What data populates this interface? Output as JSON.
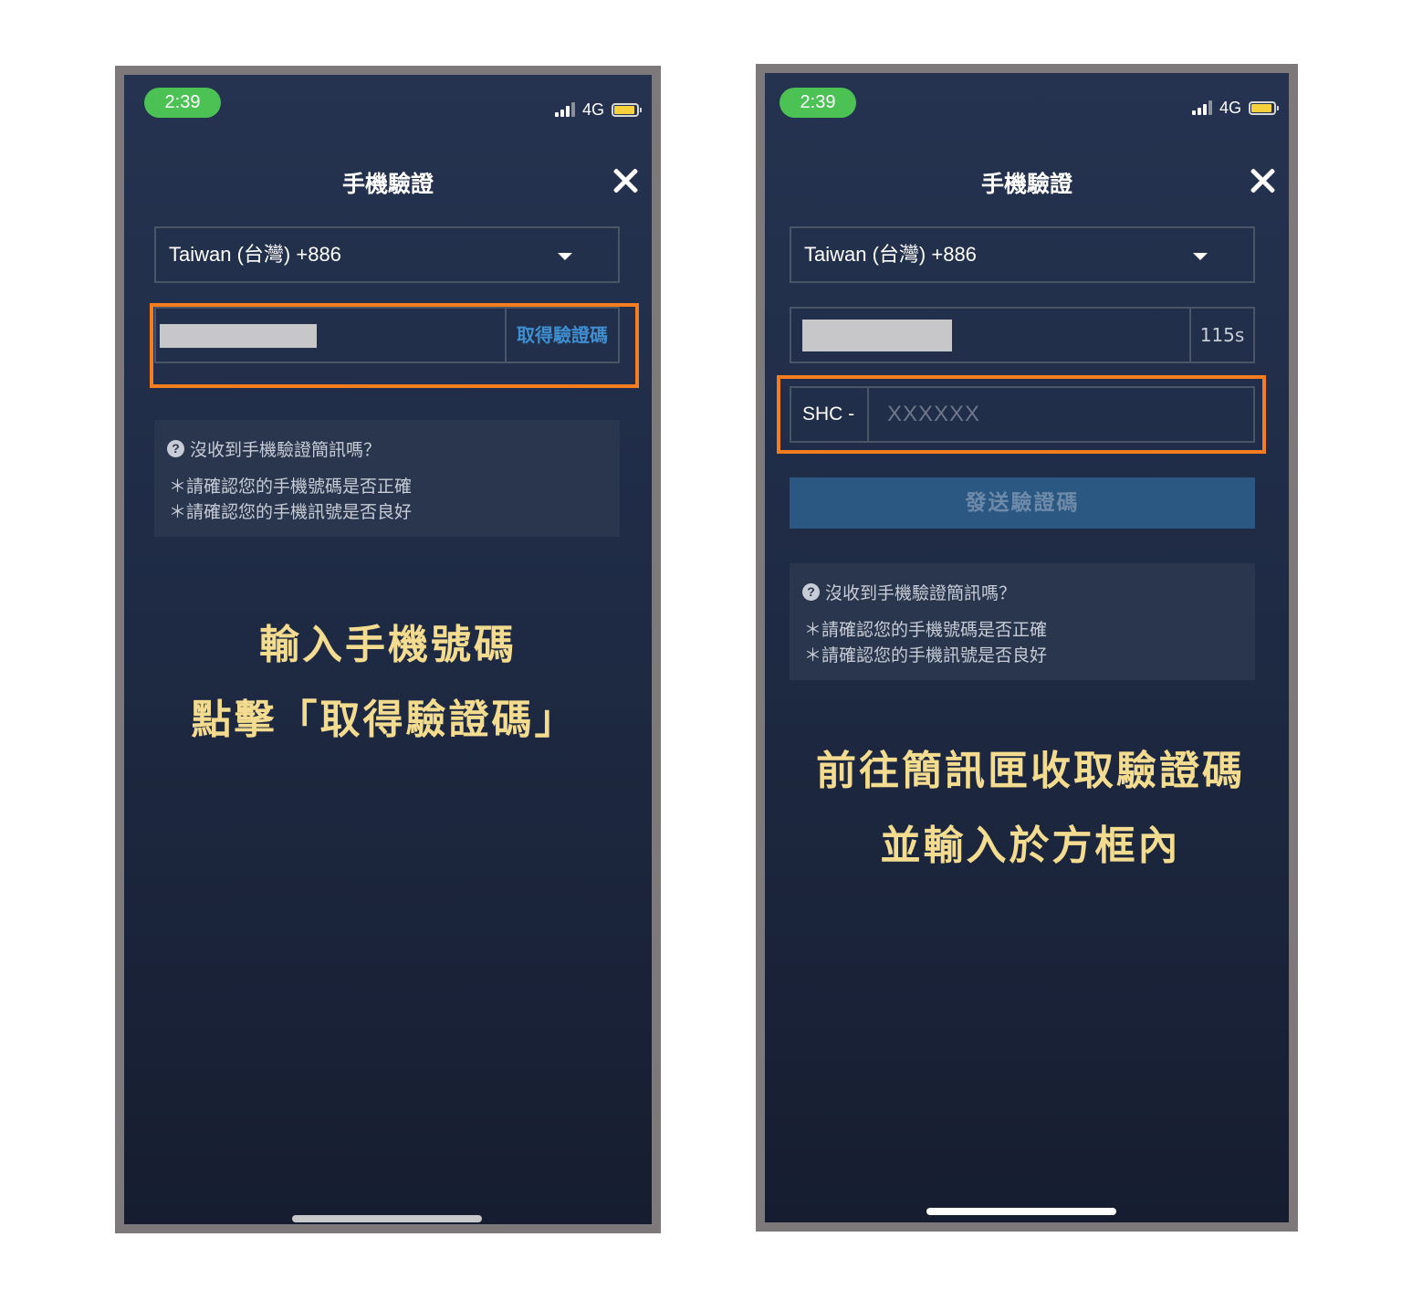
{
  "panels": [
    {
      "status_time": "2:39",
      "network": "4G",
      "title": "手機驗證",
      "country": "Taiwan (台灣) +886",
      "phone_action": "取得驗證碼",
      "help": {
        "heading": "沒收到手機驗證簡訊嗎？",
        "lines": [
          "＊請確認您的手機號碼是否正確",
          "＊請確認您的手機訊號是否良好"
        ]
      },
      "captions": [
        "輸入手機號碼",
        "點擊「取得驗證碼」"
      ]
    },
    {
      "status_time": "2:39",
      "network": "4G",
      "title": "手機驗證",
      "country": "Taiwan (台灣) +886",
      "countdown": "115s",
      "code_prefix": "SHC -",
      "code_placeholder": "XXXXXX",
      "send_label": "發送驗證碼",
      "help": {
        "heading": "沒收到手機驗證簡訊嗎？",
        "lines": [
          "＊請確認您的手機號碼是否正確",
          "＊請確認您的手機訊號是否良好"
        ]
      },
      "captions": [
        "前往簡訊匣收取驗證碼",
        "並輸入於方框內"
      ]
    }
  ],
  "colors": {
    "highlight": "#f47d20",
    "link_blue": "#3e8ed0",
    "caption_gold": "#f3dc8f",
    "status_green": "#4cc255"
  }
}
